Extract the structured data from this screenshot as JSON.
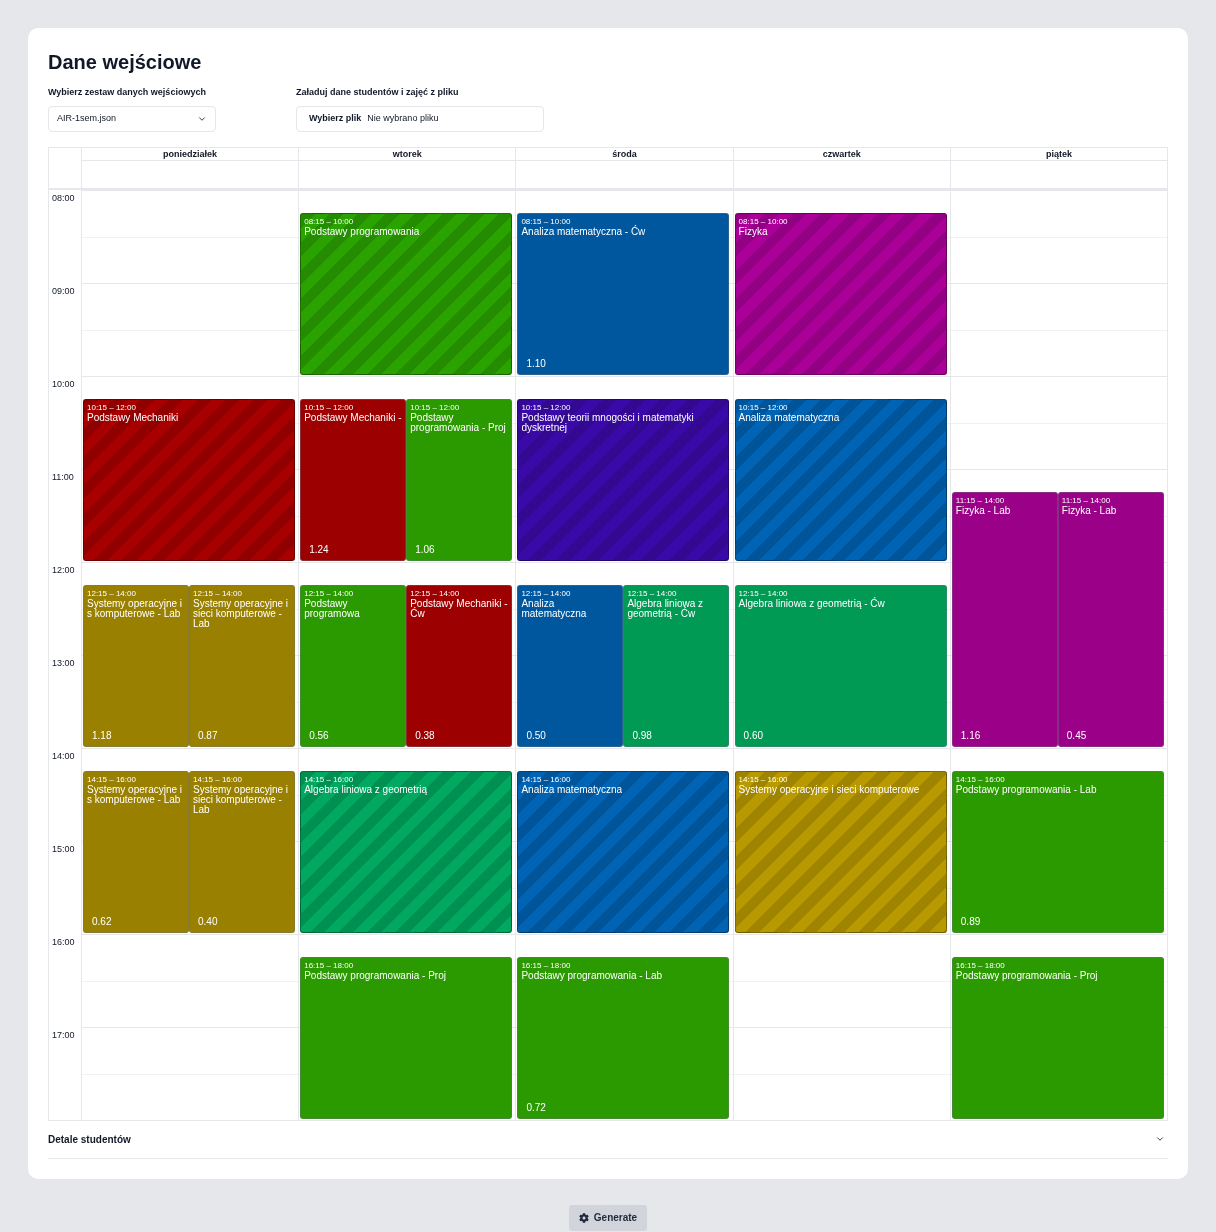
{
  "title": "Dane wejściowe",
  "dataset": {
    "label": "Wybierz zestaw danych wejściowych",
    "value": "AIR-1sem.json"
  },
  "upload": {
    "label": "Załaduj dane studentów i zajęć z pliku",
    "button": "Wybierz plik",
    "status": "Nie wybrano pliku"
  },
  "hours": [
    "08:00",
    "09:00",
    "10:00",
    "11:00",
    "12:00",
    "13:00",
    "14:00",
    "15:00",
    "16:00",
    "17:00"
  ],
  "days": [
    {
      "name": "poniedziałek",
      "events": [
        {
          "time": "10:15 – 12:00",
          "title": "Podstawy Mechaniki",
          "color": "#a80000",
          "striped": true
        },
        {
          "time": "12:15 – 14:00",
          "title": "Systemy operacyjne i s komputerowe - Lab",
          "score": "1.18",
          "color": "#9a8000",
          "striped": false
        },
        {
          "time": "12:15 – 14:00",
          "title": "Systemy operacyjne i sieci komputerowe - Lab",
          "score": "0.87",
          "color": "#9a8000",
          "striped": false
        },
        {
          "time": "14:15 – 16:00",
          "title": "Systemy operacyjne i s komputerowe - Lab",
          "score": "0.62",
          "color": "#9a8000",
          "striped": false
        },
        {
          "time": "14:15 – 16:00",
          "title": "Systemy operacyjne i sieci komputerowe - Lab",
          "score": "0.40",
          "color": "#9a8000",
          "striped": false
        }
      ]
    },
    {
      "name": "wtorek",
      "events": [
        {
          "time": "08:15 – 10:00",
          "title": "Podstawy programowania",
          "color": "#2aa300",
          "striped": true
        },
        {
          "time": "10:15 – 12:00",
          "title": "Podstawy Mechaniki -",
          "score": "1.24",
          "color": "#9c0000",
          "striped": false
        },
        {
          "time": "10:15 – 12:00",
          "title": "Podstawy programowania - Proj",
          "score": "1.06",
          "color": "#2b9a00",
          "striped": false
        },
        {
          "time": "12:15 – 14:00",
          "title": "Podstawy programowa",
          "score": "0.56",
          "color": "#2b9a00",
          "striped": false
        },
        {
          "time": "12:15 – 14:00",
          "title": "Podstawy Mechaniki - Ćw",
          "score": "0.38",
          "color": "#9c0000",
          "striped": false
        },
        {
          "time": "14:15 – 16:00",
          "title": "Algebra liniowa z geometrią",
          "color": "#00a860",
          "striped": true
        },
        {
          "time": "16:15 – 18:00",
          "title": "Podstawy programowania - Proj",
          "color": "#2b9a00",
          "striped": false
        }
      ]
    },
    {
      "name": "środa",
      "events": [
        {
          "time": "08:15 – 10:00",
          "title": "Analiza matematyczna - Ćw",
          "score": "1.10",
          "color": "#00579e",
          "striped": false
        },
        {
          "time": "10:15 – 12:00",
          "title": "Podstawy teorii mnogości i matematyki dyskretnej",
          "color": "#3a0aa8",
          "striped": true
        },
        {
          "time": "12:15 – 14:00",
          "title": "Analiza matematyczna",
          "score": "0.50",
          "color": "#00579e",
          "striped": false
        },
        {
          "time": "12:15 – 14:00",
          "title": "Algebra liniowa z geometrią - Ćw",
          "score": "0.98",
          "color": "#009a55",
          "striped": false
        },
        {
          "time": "14:15 – 16:00",
          "title": "Analiza matematyczna",
          "color": "#0063b3",
          "striped": true
        },
        {
          "time": "16:15 – 18:00",
          "title": "Podstawy programowania - Lab",
          "score": "0.72",
          "color": "#2b9a00",
          "striped": false
        }
      ]
    },
    {
      "name": "czwartek",
      "events": [
        {
          "time": "08:15 – 10:00",
          "title": "Fizyka",
          "color": "#aa0098",
          "striped": true
        },
        {
          "time": "10:15 – 12:00",
          "title": "Analiza matematyczna",
          "color": "#0063b3",
          "striped": true
        },
        {
          "time": "12:15 – 14:00",
          "title": "Algebra liniowa z geometrią - Ćw",
          "score": "0.60",
          "color": "#009a55",
          "striped": false
        },
        {
          "time": "14:15 – 16:00",
          "title": "Systemy operacyjne i sieci komputerowe",
          "color": "#b89a00",
          "striped": true
        }
      ]
    },
    {
      "name": "piątek",
      "events": [
        {
          "time": "11:15 – 14:00",
          "title": "Fizyka - Lab",
          "score": "1.16",
          "color": "#9a0088",
          "striped": false
        },
        {
          "time": "11:15 – 14:00",
          "title": "Fizyka - Lab",
          "score": "0.45",
          "color": "#9a0088",
          "striped": false
        },
        {
          "time": "14:15 – 16:00",
          "title": "Podstawy programowania - Lab",
          "score": "0.89",
          "color": "#2b9a00",
          "striped": false
        },
        {
          "time": "16:15 – 18:00",
          "title": "Podstawy programowania - Proj",
          "color": "#2b9a00",
          "striped": false
        }
      ]
    }
  ],
  "details": {
    "label": "Detale studentów",
    "expanded": false
  },
  "generate": "Generate"
}
